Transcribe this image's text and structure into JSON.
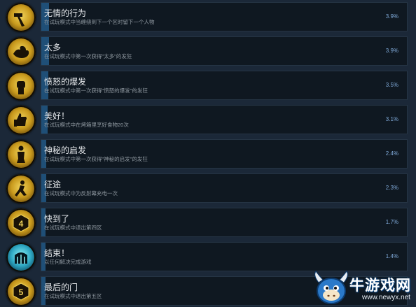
{
  "achievements": [
    {
      "title": "无情的行为",
      "desc": "在试玩模式中当缠绕到下一个区时留下一个人物",
      "percent_label": "3.9%",
      "percent": 3.9,
      "icon": "hammer-icon",
      "icon_color": "gold"
    },
    {
      "title": "太多",
      "desc": "在试玩模式中第一次获得\"太多\"的发狂",
      "percent_label": "3.9%",
      "percent": 3.9,
      "icon": "grabbing-hands-icon",
      "icon_color": "gold"
    },
    {
      "title": "愤怒的爆发",
      "desc": "在试玩模式中第一次获得\"愤怒的爆发\"的发狂",
      "percent_label": "3.5%",
      "percent": 3.5,
      "icon": "raised-fist-icon",
      "icon_color": "gold"
    },
    {
      "title": "美好！",
      "desc": "在试玩模式中在烤箱里烹好食物20次",
      "percent_label": "3.1%",
      "percent": 3.1,
      "icon": "thumbs-up-icon",
      "icon_color": "gold"
    },
    {
      "title": "神秘的启发",
      "desc": "在试玩模式中第一次获得\"神秘的启发\"的发狂",
      "percent_label": "2.4%",
      "percent": 2.4,
      "icon": "figure-icon",
      "icon_color": "gold"
    },
    {
      "title": "征途",
      "desc": "在试玩模式中为反射幕充电一次",
      "percent_label": "2.3%",
      "percent": 2.3,
      "icon": "running-figure-icon",
      "icon_color": "gold"
    },
    {
      "title": "快到了",
      "desc": "在试玩模式中退出第四区",
      "percent_label": "1.7%",
      "percent": 1.7,
      "icon": "zone-4-badge-icon",
      "icon_color": "gold",
      "icon_text": "4"
    },
    {
      "title": "结束！",
      "desc": "以任何解决完成游戏",
      "percent_label": "1.4%",
      "percent": 1.4,
      "icon": "gate-icon",
      "icon_color": "blue"
    },
    {
      "title": "最后的门",
      "desc": "在试玩模式中退出第五区",
      "percent_label": "",
      "percent": 1.2,
      "icon": "zone-5-badge-icon",
      "icon_color": "gold",
      "icon_text": "5"
    }
  ],
  "watermark": {
    "name": "牛游戏网",
    "url": "www.newyx.net"
  },
  "colors": {
    "background": "#1b2838",
    "bar": "#1f4f77",
    "percent_text": "#7fa9d8"
  }
}
